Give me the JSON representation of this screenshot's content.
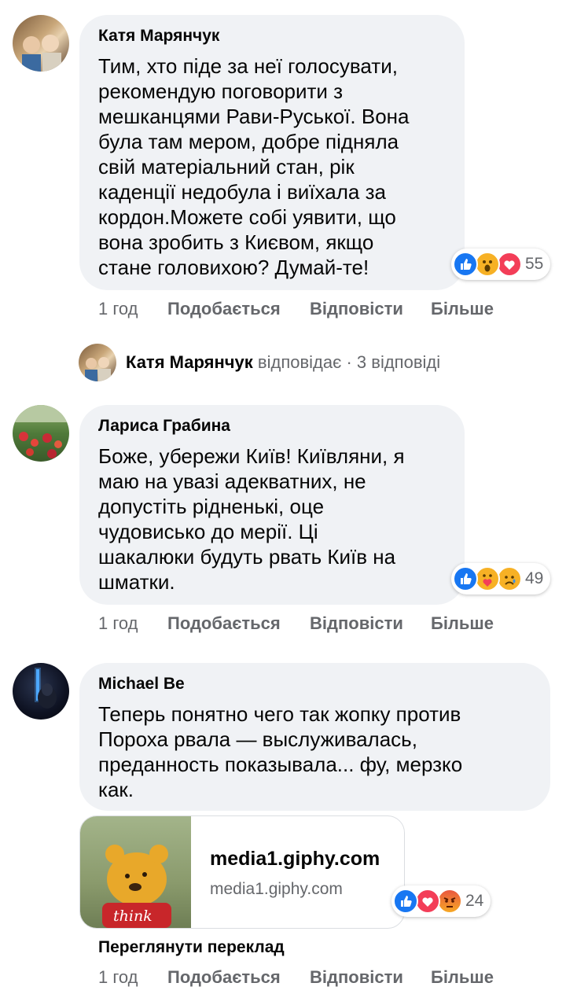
{
  "comments": [
    {
      "author": "Катя Марянчук",
      "lines": [
        "Тим, хто піде за неї голосувати,",
        "рекомендую поговорити з",
        "мешканцями Рави-Руської. Вона",
        "була там мером, добре підняла",
        "свій матеріальний стан, рік",
        "каденції недобула і виїхала за",
        "кордон.Можете собі уявити, що",
        "вона зробить з Києвом, якщо",
        "стане головихою? Думай-те!"
      ],
      "reactions": [
        "like",
        "wow",
        "love"
      ],
      "reaction_count": "55",
      "time": "1 год",
      "like_label": "Подобається",
      "reply_label": "Відповісти",
      "more_label": "Більше"
    },
    {
      "author": "Лариса Грабина",
      "lines": [
        "Боже, убережи Київ! Київляни, я",
        "маю на увазі адекватних, не",
        "допустіть рідненькі, оце",
        "чудовисько до мерії. Ці",
        "шакалюки будуть рвать Київ на",
        "шматки."
      ],
      "reactions": [
        "like",
        "care",
        "sad"
      ],
      "reaction_count": "49",
      "time": "1 год",
      "like_label": "Подобається",
      "reply_label": "Відповісти",
      "more_label": "Більше"
    },
    {
      "author": "Michael Be",
      "lines": [
        "Теперь понятно чего так жопку против",
        "Пороха рвала — выслуживалась,",
        "преданность показывала... фу, мерзко",
        "как."
      ],
      "link_preview": {
        "title": "media1.giphy.com",
        "domain": "media1.giphy.com",
        "image_caption": "think"
      },
      "reactions": [
        "like",
        "love",
        "angry"
      ],
      "reaction_count": "24",
      "see_translation": "Переглянути переклад",
      "time": "1 год",
      "like_label": "Подобається",
      "reply_label": "Відповісти",
      "more_label": "Більше"
    }
  ],
  "reply_summary": {
    "author": "Катя Марянчук",
    "verb": "відповідає",
    "separator": "·",
    "count_text": "3 відповіді"
  },
  "colors": {
    "bubble": "#f0f2f5",
    "secondary_text": "#65676b",
    "like_blue": "#1877f2",
    "love_red": "#f33e58",
    "wow_yellow": "#f7b125"
  }
}
